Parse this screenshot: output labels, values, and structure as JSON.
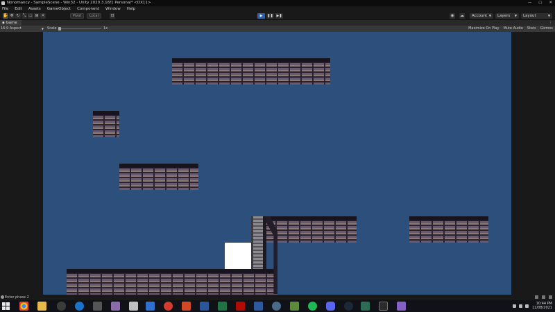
{
  "window": {
    "title": "Nonomancy - SampleScene - Win32 - Unity 2020.3.16f1 Personal* <DX11>",
    "controls": [
      "—",
      "▢",
      "✕"
    ]
  },
  "menu": [
    "File",
    "Edit",
    "Assets",
    "GameObject",
    "Component",
    "Window",
    "Help"
  ],
  "toolbar": {
    "tools": [
      "hand-tool",
      "move-tool",
      "rotate-tool",
      "scale-tool",
      "rect-tool",
      "transform-tool",
      "custom-tool"
    ],
    "pivot_label": "Pivot",
    "local_label": "Local",
    "play_buttons": [
      "▶",
      "❚❚",
      "▶❚"
    ],
    "account_label": "Account",
    "layers_label": "Layers",
    "layout_label": "Layout"
  },
  "game_tab": {
    "label": "Game",
    "more": "⋮"
  },
  "game_toolbar": {
    "aspect": "16:9 Aspect",
    "scale_label": "Scale",
    "scale_value": "1x",
    "maximize": "Maximize On Play",
    "mute": "Mute Audio",
    "stats": "Stats",
    "gizmos": "Gizmos"
  },
  "scene": {
    "background_color": "#2d4f7c",
    "brick_color": "#4b3d52",
    "player_color": "#ffffff"
  },
  "status": {
    "message": "Enter phase 2"
  },
  "taskbar": {
    "apps": [
      "chrome",
      "file-explorer",
      "game-controller",
      "network",
      "pen",
      "photos",
      "paint",
      "media",
      "powerpoint",
      "word",
      "excel",
      "acrobat",
      "book",
      "settings",
      "minecraft",
      "spotify",
      "discord",
      "steam",
      "terminal",
      "unity",
      "visual-studio"
    ],
    "time": "10:44 PM",
    "date": "12/08/2021"
  }
}
